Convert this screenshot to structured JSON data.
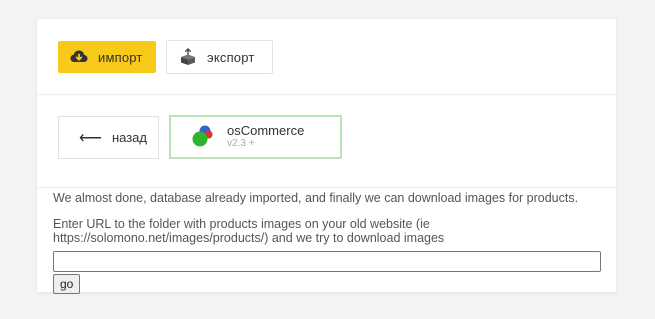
{
  "toolbar": {
    "import_label": "импорт",
    "import_icon": "cloud-download-icon",
    "export_label": "экспорт",
    "export_icon": "box-upload-icon",
    "accent_color": "#f7c91a"
  },
  "nav": {
    "back_label": "назад",
    "back_icon": "arrow-left-icon"
  },
  "platform": {
    "name": "osCommerce",
    "version": "v2.3 +",
    "logo_icon": "oscommerce-logo-icon",
    "selected_border_color": "#b9e3b8"
  },
  "content": {
    "status_message": "We almost done, database already imported, and finally we can download images for products.",
    "url_prompt": "Enter URL to the folder with products images on your old website (ie https://solomono.net/images/products/) and we try to download images",
    "url_value": "",
    "go_label": "go"
  }
}
